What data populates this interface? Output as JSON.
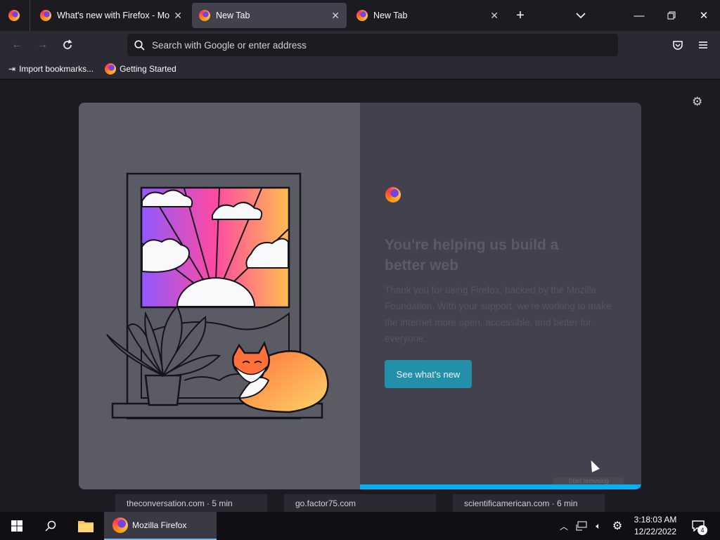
{
  "tabs": [
    {
      "title": "What's new with Firefox - More",
      "active": false
    },
    {
      "title": "New Tab",
      "active": true
    },
    {
      "title": "New Tab",
      "active": false
    }
  ],
  "urlbar": {
    "placeholder": "Search with Google or enter address"
  },
  "bookmarks": [
    {
      "label": "Import bookmarks..."
    },
    {
      "label": "Getting Started"
    }
  ],
  "modal": {
    "heading": "You're helping us build a better web",
    "body": "Thank you for using Firefox, backed by the Mozilla Foundation. With your support, we're working to make the internet more open, accessible, and better for everyone.",
    "cta": "See what's new",
    "skip": "Start browsing",
    "progress": 0.5
  },
  "top_sites": [
    {
      "label": "theconversation.com · 5 min"
    },
    {
      "label": "go.factor75.com"
    },
    {
      "label": "scientificamerican.com · 6 min"
    }
  ],
  "taskbar": {
    "app_label": "Mozilla Firefox",
    "time": "3:18:03 AM",
    "date": "12/22/2022",
    "notifications": "4"
  },
  "colors": {
    "accent": "#00b3f4",
    "cta": "#2190a8",
    "tab_active": "#42414d"
  }
}
